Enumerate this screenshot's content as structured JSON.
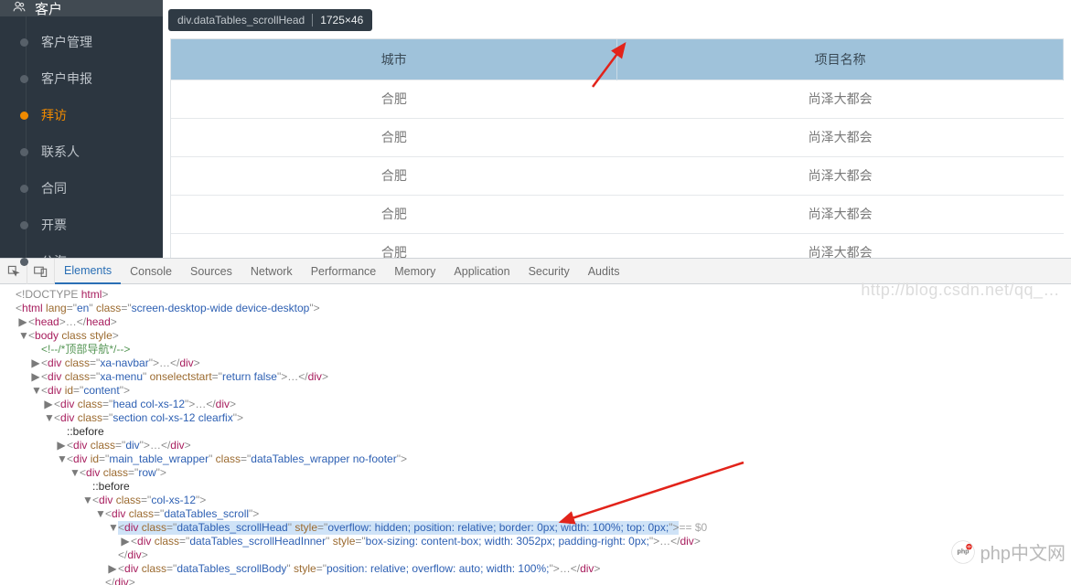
{
  "sidebar": {
    "head_icon": "users-icon",
    "head_label": "客户",
    "items": [
      {
        "label": "客户管理",
        "active": false
      },
      {
        "label": "客户申报",
        "active": false
      },
      {
        "label": "拜访",
        "active": true
      },
      {
        "label": "联系人",
        "active": false
      },
      {
        "label": "合同",
        "active": false
      },
      {
        "label": "开票",
        "active": false
      },
      {
        "label": "公海",
        "active": false
      }
    ]
  },
  "inspector_tip": {
    "selector": "div.dataTables_scrollHead",
    "size": "1725×46"
  },
  "table": {
    "headers": [
      "城市",
      "项目名称"
    ],
    "rows": [
      [
        "合肥",
        "尚泽大都会"
      ],
      [
        "合肥",
        "尚泽大都会"
      ],
      [
        "合肥",
        "尚泽大都会"
      ],
      [
        "合肥",
        "尚泽大都会"
      ],
      [
        "合肥",
        "尚泽大都会"
      ]
    ]
  },
  "devtools": {
    "tabs": [
      "Elements",
      "Console",
      "Sources",
      "Network",
      "Performance",
      "Memory",
      "Application",
      "Security",
      "Audits"
    ],
    "active_tab_index": 0,
    "dom_lines": [
      {
        "indent": 0,
        "tw": " ",
        "html": "<span class='t-pun'>&lt;!DOCTYPE </span><span class='t-tag'>html</span><span class='t-pun'>&gt;</span>"
      },
      {
        "indent": 0,
        "tw": " ",
        "html": "<span class='t-pun'>&lt;</span><span class='t-tag'>html</span> <span class='t-attr'>lang</span><span class='t-pun'>=\"</span><span class='t-val'>en</span><span class='t-pun'>\"</span> <span class='t-attr'>class</span><span class='t-pun'>=\"</span><span class='t-val'>screen-desktop-wide device-desktop</span><span class='t-pun'>\"&gt;</span>"
      },
      {
        "indent": 1,
        "tw": "▶",
        "html": "<span class='t-pun'>&lt;</span><span class='t-tag'>head</span><span class='t-pun'>&gt;…&lt;/</span><span class='t-tag'>head</span><span class='t-pun'>&gt;</span>"
      },
      {
        "indent": 1,
        "tw": "▼",
        "html": "<span class='t-pun'>&lt;</span><span class='t-tag'>body</span> <span class='t-attr'>class</span> <span class='t-attr'>style</span><span class='t-pun'>&gt;</span>"
      },
      {
        "indent": 2,
        "tw": " ",
        "html": "<span class='t-com'>&lt;!--/*顶部导航*/--&gt;</span>"
      },
      {
        "indent": 2,
        "tw": "▶",
        "html": "<span class='t-pun'>&lt;</span><span class='t-tag'>div</span> <span class='t-attr'>class</span><span class='t-pun'>=\"</span><span class='t-val'>xa-navbar</span><span class='t-pun'>\"&gt;…&lt;/</span><span class='t-tag'>div</span><span class='t-pun'>&gt;</span>"
      },
      {
        "indent": 2,
        "tw": "▶",
        "html": "<span class='t-pun'>&lt;</span><span class='t-tag'>div</span> <span class='t-attr'>class</span><span class='t-pun'>=\"</span><span class='t-val'>xa-menu</span><span class='t-pun'>\"</span> <span class='t-attr'>onselectstart</span><span class='t-pun'>=\"</span><span class='t-val'>return false</span><span class='t-pun'>\"&gt;…&lt;/</span><span class='t-tag'>div</span><span class='t-pun'>&gt;</span>"
      },
      {
        "indent": 2,
        "tw": "▼",
        "html": "<span class='t-pun'>&lt;</span><span class='t-tag'>div</span> <span class='t-attr'>id</span><span class='t-pun'>=\"</span><span class='t-val'>content</span><span class='t-pun'>\"&gt;</span>"
      },
      {
        "indent": 3,
        "tw": "▶",
        "html": "<span class='t-pun'>&lt;</span><span class='t-tag'>div</span> <span class='t-attr'>class</span><span class='t-pun'>=\"</span><span class='t-val'>head col-xs-12</span><span class='t-pun'>\"&gt;…&lt;/</span><span class='t-tag'>div</span><span class='t-pun'>&gt;</span>"
      },
      {
        "indent": 3,
        "tw": "▼",
        "html": "<span class='t-pun'>&lt;</span><span class='t-tag'>div</span> <span class='t-attr'>class</span><span class='t-pun'>=\"</span><span class='t-val'>section col-xs-12 clearfix</span><span class='t-pun'>\"&gt;</span>"
      },
      {
        "indent": 4,
        "tw": " ",
        "html": "<span class='t-txt'>::before</span>"
      },
      {
        "indent": 4,
        "tw": "▶",
        "html": "<span class='t-pun'>&lt;</span><span class='t-tag'>div</span> <span class='t-attr'>class</span><span class='t-pun'>=\"</span><span class='t-val'>div</span><span class='t-pun'>\"&gt;…&lt;/</span><span class='t-tag'>div</span><span class='t-pun'>&gt;</span>"
      },
      {
        "indent": 4,
        "tw": "▼",
        "html": "<span class='t-pun'>&lt;</span><span class='t-tag'>div</span> <span class='t-attr'>id</span><span class='t-pun'>=\"</span><span class='t-val'>main_table_wrapper</span><span class='t-pun'>\"</span> <span class='t-attr'>class</span><span class='t-pun'>=\"</span><span class='t-val'>dataTables_wrapper no-footer</span><span class='t-pun'>\"&gt;</span>"
      },
      {
        "indent": 5,
        "tw": "▼",
        "html": "<span class='t-pun'>&lt;</span><span class='t-tag'>div</span> <span class='t-attr'>class</span><span class='t-pun'>=\"</span><span class='t-val'>row</span><span class='t-pun'>\"&gt;</span>"
      },
      {
        "indent": 6,
        "tw": " ",
        "html": "<span class='t-txt'>::before</span>"
      },
      {
        "indent": 6,
        "tw": "▼",
        "html": "<span class='t-pun'>&lt;</span><span class='t-tag'>div</span> <span class='t-attr'>class</span><span class='t-pun'>=\"</span><span class='t-val'>col-xs-12</span><span class='t-pun'>\"&gt;</span>"
      },
      {
        "indent": 7,
        "tw": "▼",
        "html": "<span class='t-pun'>&lt;</span><span class='t-tag'>div</span> <span class='t-attr'>class</span><span class='t-pun'>=\"</span><span class='t-val'>dataTables_scroll</span><span class='t-pun'>\"&gt;</span>"
      },
      {
        "indent": 8,
        "tw": "▼",
        "hl": true,
        "post": " == $0",
        "html": "<span class='t-pun'>&lt;</span><span class='t-tag'>div</span> <span class='t-attr'>class</span><span class='t-pun'>=\"</span><span class='t-val'>dataTables_scrollHead</span><span class='t-pun'>\"</span> <span class='t-attr'>style</span><span class='t-pun'>=\"</span><span class='t-val'>overflow: hidden; position: relative; border: 0px; width: 100%; top: 0px;</span><span class='t-pun'>\"&gt;</span>"
      },
      {
        "indent": 9,
        "tw": "▶",
        "html": "<span class='t-pun'>&lt;</span><span class='t-tag'>div</span> <span class='t-attr'>class</span><span class='t-pun'>=\"</span><span class='t-val'>dataTables_scrollHeadInner</span><span class='t-pun'>\"</span> <span class='t-attr'>style</span><span class='t-pun'>=\"</span><span class='t-val'>box-sizing: content-box; width: 3052px; padding-right: 0px;</span><span class='t-pun'>\"&gt;…&lt;/</span><span class='t-tag'>div</span><span class='t-pun'>&gt;</span>"
      },
      {
        "indent": 8,
        "tw": " ",
        "html": "<span class='t-pun'>&lt;/</span><span class='t-tag'>div</span><span class='t-pun'>&gt;</span>"
      },
      {
        "indent": 8,
        "tw": "▶",
        "html": "<span class='t-pun'>&lt;</span><span class='t-tag'>div</span> <span class='t-attr'>class</span><span class='t-pun'>=\"</span><span class='t-val'>dataTables_scrollBody</span><span class='t-pun'>\"</span> <span class='t-attr'>style</span><span class='t-pun'>=\"</span><span class='t-val'>position: relative; overflow: auto; width: 100%;</span><span class='t-pun'>\"&gt;…&lt;/</span><span class='t-tag'>div</span><span class='t-pun'>&gt;</span>"
      },
      {
        "indent": 7,
        "tw": " ",
        "html": "<span class='t-pun'>&lt;/</span><span class='t-tag'>div</span><span class='t-pun'>&gt;</span>"
      }
    ]
  },
  "watermark": {
    "url": "http://blog.csdn.net/qq_…",
    "brand": "php中文网"
  }
}
